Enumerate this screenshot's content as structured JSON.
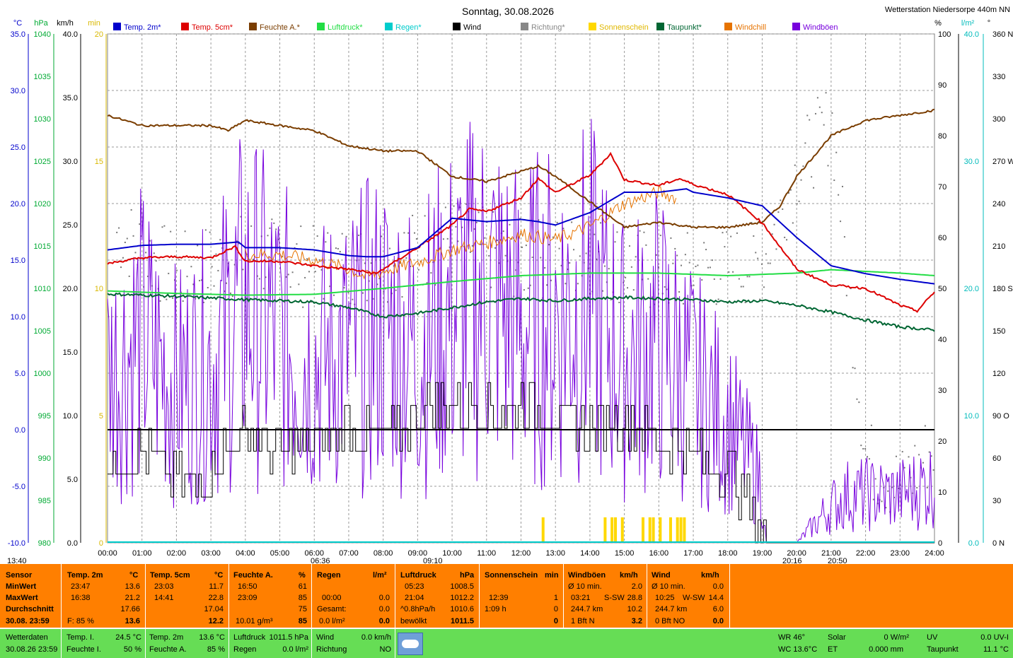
{
  "header": {
    "title": "Sonntag, 30.08.2026",
    "station": "Wetterstation Niedersorpe 440m NN"
  },
  "legend": [
    {
      "label": "Temp. 2m*",
      "color": "#0000cc"
    },
    {
      "label": "Temp. 5cm*",
      "color": "#dd0000"
    },
    {
      "label": "Feuchte A.*",
      "color": "#7a3d00"
    },
    {
      "label": "Luftdruck*",
      "color": "#22dd44"
    },
    {
      "label": "Regen*",
      "color": "#00cccc"
    },
    {
      "label": "Wind",
      "color": "#000000"
    },
    {
      "label": "Richtung*",
      "color": "#888888"
    },
    {
      "label": "Sonnenschein",
      "color": "#ffd800"
    },
    {
      "label": "Taupunkt*",
      "color": "#006633"
    },
    {
      "label": "Windchill",
      "color": "#e67300"
    },
    {
      "label": "Windböen",
      "color": "#7700dd"
    }
  ],
  "axes": {
    "left_units": [
      "°C",
      "hPa",
      "km/h",
      "min"
    ],
    "right_units": [
      "%",
      "l/m²",
      "°"
    ],
    "temp_ticks": [
      "35.0",
      "30.0",
      "25.0",
      "20.0",
      "15.0",
      "10.0",
      "5.0",
      "0.0",
      "-5.0",
      "-10.0"
    ],
    "hpa_ticks": [
      "1040",
      "1035",
      "1030",
      "1025",
      "1020",
      "1015",
      "1010",
      "1005",
      "1000",
      "995",
      "990",
      "985",
      "980"
    ],
    "kmh_ticks": [
      "40.0",
      "35.0",
      "30.0",
      "25.0",
      "20.0",
      "15.0",
      "10.0",
      "5.0",
      "0.0"
    ],
    "min_ticks": [
      "20",
      "15",
      "10",
      "5",
      "0"
    ],
    "pct_ticks": [
      "100",
      "90",
      "80",
      "70",
      "60",
      "50",
      "40",
      "30",
      "20",
      "10",
      "0"
    ],
    "rain_ticks": [
      "40.0",
      "30.0",
      "20.0",
      "10.0",
      "0.0"
    ],
    "dir_ticks": [
      "360 N",
      "330",
      "300",
      "270 W",
      "240",
      "210",
      "180 S",
      "150",
      "120",
      "90  O",
      "60",
      "30",
      "0  N"
    ],
    "x_ticks": [
      "00:00",
      "01:00",
      "02:00",
      "03:00",
      "04:00",
      "05:00",
      "06:00",
      "07:00",
      "08:00",
      "09:00",
      "10:00",
      "11:00",
      "12:00",
      "13:00",
      "14:00",
      "15:00",
      "16:00",
      "17:00",
      "18:00",
      "19:00",
      "20:00",
      "21:00",
      "22:00",
      "23:00",
      "24:00"
    ],
    "events": {
      "e1": "13:40",
      "e2": "06:36",
      "e3": "09:10",
      "e4": "20:16",
      "e5": "20:50"
    }
  },
  "chart_data": {
    "type": "line",
    "title": "Sonntag, 30.08.2026",
    "x_unit": "hour of day",
    "xlim": [
      0,
      24
    ],
    "ylim_temp_c": [
      -10,
      35
    ],
    "ylim_pressure_hpa": [
      980,
      1040
    ],
    "ylim_wind_kmh": [
      0,
      40
    ],
    "ylim_sun_min": [
      0,
      20
    ],
    "ylim_humidity_pct": [
      0,
      100
    ],
    "ylim_rain_lm2": [
      0,
      40
    ],
    "ylim_direction_deg": [
      0,
      360
    ],
    "grid": true,
    "legend": "top",
    "series": [
      {
        "name": "Temp. 2m*",
        "unit": "°C",
        "x": [
          0,
          1,
          2,
          3,
          3.8,
          4,
          5,
          6,
          7,
          7.5,
          8,
          9,
          10,
          11,
          12,
          12.5,
          13,
          14,
          15,
          16,
          16.8,
          17,
          18,
          19,
          20,
          21,
          22,
          23,
          24
        ],
        "values": [
          15.9,
          16.3,
          16.4,
          16.4,
          16.6,
          16.1,
          16.1,
          15.9,
          15.4,
          15.3,
          15.3,
          16.1,
          18.7,
          18.4,
          18.6,
          18.4,
          18.1,
          19.2,
          21.0,
          21.0,
          21.3,
          21.0,
          20.5,
          19.8,
          17.0,
          14.5,
          13.8,
          13.3,
          12.9
        ]
      },
      {
        "name": "Temp. 5cm*",
        "unit": "°C",
        "x": [
          0,
          1,
          2,
          3,
          3.7,
          4,
          5,
          6,
          7,
          7.8,
          8,
          9,
          10,
          10.5,
          11,
          12,
          12.5,
          13,
          14,
          14.6,
          15,
          16,
          16.6,
          17,
          18,
          19,
          20,
          21,
          22,
          23,
          23.5,
          24
        ],
        "values": [
          14.7,
          15.2,
          15.3,
          15.2,
          16.2,
          14.9,
          14.9,
          14.5,
          14.2,
          13.8,
          14.2,
          16.1,
          18.1,
          19.5,
          19.3,
          20.5,
          22.2,
          21.0,
          22.5,
          24.4,
          22.1,
          21.6,
          22.2,
          21.7,
          20.8,
          18.3,
          14.2,
          12.8,
          12.5,
          11.0,
          10.5,
          12.2
        ]
      },
      {
        "name": "Feuchte A.*",
        "unit": "%",
        "x": [
          0,
          0.5,
          1,
          2,
          3,
          3.5,
          4,
          5,
          6,
          7,
          8,
          9,
          10,
          11,
          12,
          12.5,
          13,
          14,
          15,
          16,
          17,
          18,
          19,
          19.5,
          20,
          21,
          22,
          23,
          24
        ],
        "values": [
          84,
          83,
          82,
          82,
          82,
          81,
          83,
          82,
          81,
          78,
          77,
          77,
          72,
          71,
          73,
          74,
          72,
          67,
          62,
          63,
          62,
          62,
          63,
          66,
          72,
          80,
          83,
          84,
          85
        ]
      },
      {
        "name": "Luftdruck*",
        "unit": "hPa",
        "x": [
          0,
          2,
          4,
          6,
          8,
          10,
          12,
          14,
          16,
          18,
          20,
          21,
          22,
          23,
          24
        ],
        "values": [
          1009.7,
          1009.4,
          1009.2,
          1009.3,
          1010.0,
          1010.8,
          1011.5,
          1011.8,
          1011.8,
          1011.5,
          1011.8,
          1012.2,
          1012.0,
          1011.8,
          1011.5
        ]
      },
      {
        "name": "Taupunkt*",
        "unit": "°C",
        "x": [
          0,
          2,
          4,
          6,
          7,
          8,
          9,
          10,
          11,
          12,
          13,
          14,
          15,
          16,
          17,
          18,
          19,
          20,
          21,
          22,
          23,
          24
        ],
        "values": [
          12.0,
          11.8,
          11.5,
          11.3,
          10.8,
          10.0,
          10.3,
          10.8,
          11.3,
          11.6,
          11.4,
          11.6,
          11.7,
          11.6,
          11.5,
          11.3,
          11.4,
          11.0,
          10.4,
          9.7,
          9.1,
          8.8
        ]
      },
      {
        "name": "Windchill",
        "unit": "°C",
        "x": [
          4,
          5,
          6,
          7,
          7.5,
          8,
          9,
          10,
          11,
          12,
          13,
          14,
          15,
          16,
          16.5
        ],
        "values": [
          15.5,
          15.5,
          15.0,
          14.2,
          13.5,
          14.0,
          14.8,
          15.9,
          16.5,
          17.3,
          16.8,
          18.0,
          20.0,
          21.0,
          20.5
        ]
      },
      {
        "name": "Wind",
        "unit": "km/h",
        "x": [
          0,
          1,
          2,
          2.5,
          3,
          4,
          5,
          6,
          7,
          8,
          9,
          10,
          11,
          12,
          13,
          14,
          15,
          16,
          17,
          18,
          19,
          19.2,
          20,
          21,
          22,
          23,
          24
        ],
        "values": [
          6,
          7,
          5,
          4,
          6,
          9,
          7,
          8,
          9,
          8,
          10,
          11,
          10,
          11,
          10,
          9,
          10,
          8,
          7,
          6,
          1,
          0,
          0,
          0,
          0,
          0,
          0
        ]
      },
      {
        "name": "Windböen",
        "unit": "km/h",
        "x": [
          0,
          1,
          2,
          3,
          4,
          5,
          6,
          7,
          8,
          9,
          10,
          11,
          12,
          13,
          14,
          15,
          16,
          17,
          18,
          19,
          19.1,
          20,
          21,
          21.5,
          22,
          23,
          24
        ],
        "values": [
          14,
          17,
          13,
          15,
          20,
          17,
          15,
          16,
          18,
          16,
          19,
          21,
          18,
          19,
          20,
          15,
          17,
          13,
          10,
          5,
          0,
          0,
          3,
          4,
          4,
          4,
          5
        ]
      },
      {
        "name": "Sonnenschein",
        "unit": "min",
        "x": [
          12.6,
          14.4,
          14.6,
          14.7,
          14.9,
          15.5,
          15.7,
          15.8,
          16.0,
          16.3,
          16.5,
          16.6,
          16.7
        ],
        "values": [
          1,
          1,
          1,
          1,
          1,
          1,
          1,
          1,
          1,
          1,
          1,
          1,
          1
        ]
      },
      {
        "name": "Richtung*",
        "unit": "°",
        "x": [
          0,
          2,
          4,
          6,
          8,
          10,
          12,
          14,
          16,
          18,
          19,
          20,
          21,
          22,
          23,
          24
        ],
        "values": [
          225,
          190,
          205,
          195,
          200,
          215,
          200,
          205,
          190,
          195,
          200,
          265,
          300,
          60,
          40,
          70
        ]
      }
    ]
  },
  "summary": {
    "headers": {
      "sensor": "Sensor",
      "t2": "Temp. 2m",
      "t2u": "°C",
      "t5": "Temp. 5cm",
      "t5u": "°C",
      "fa": "Feuchte A.",
      "fau": "%",
      "rg": "Regen",
      "rgu": "l/m²",
      "lp": "Luftdruck",
      "lpu": "hPa",
      "ss": "Sonnenschein",
      "ssu": "min",
      "wb": "Windböen",
      "wbu": "km/h",
      "wi": "Wind",
      "wiu": "km/h"
    },
    "rows": {
      "min": "MinWert",
      "max": "MaxWert",
      "avg": "Durchschnitt",
      "date": "30.08. 23:59"
    },
    "t2": {
      "min_time": "23:47",
      "min": "13.6",
      "max_time": "16:38",
      "max": "21.2",
      "avg": "17.66",
      "f": "F: 85 %",
      "cur": "13.6"
    },
    "t5": {
      "min_time": "23:03",
      "min": "11.7",
      "max_time": "14:41",
      "max": "22.8",
      "avg": "17.04",
      "cur": "12.2"
    },
    "fa": {
      "min_time": "16:50",
      "min": "61",
      "max_time": "23:09",
      "max": "85",
      "avg": "75",
      "abs": "10.01 g/m³",
      "cur": "85"
    },
    "rg": {
      "time": "00:00",
      "val": "0.0",
      "gesamt_label": "Gesamt:",
      "gesamt": "0.0",
      "cur_rate": "0.0 l/m²",
      "cur": "0.0"
    },
    "lp": {
      "min_time": "05:23",
      "min": "1008.5",
      "max_time": "21:04",
      "max": "1012.2",
      "trend": "^0.8hPa/h",
      "avg": "1010.6",
      "state": "bewölkt",
      "cur": "1011.5"
    },
    "ss": {
      "max_time": "12:39",
      "max": "1",
      "dur": "1:09 h",
      "dur_val": "0",
      "cur": "0"
    },
    "wb": {
      "avg_label": "Ø 10 min.",
      "avg": "2.0",
      "max_time": "03:21",
      "max_dir": "S-SW",
      "max": "28.8",
      "dist": "244.7 km",
      "dist_val": "10.2",
      "bft": "1 Bft N",
      "cur": "3.2"
    },
    "wi": {
      "avg_label": "Ø 10 min.",
      "avg": "0.0",
      "max_time": "10:25",
      "max_dir": "W-SW",
      "max": "14.4",
      "dist": "244.7 km",
      "dist_val": "6.0",
      "bft": "0 Bft NO",
      "cur": "0.0"
    }
  },
  "bottom": {
    "label": "Wetterdaten",
    "date": "30.08.26 23:59",
    "ti_label": "Temp. I.",
    "ti": "24.5 °C",
    "fi_label": "Feuchte I.",
    "fi": "50 %",
    "t2_label": "Temp. 2m",
    "t2": "13.6 °C",
    "fa_label": "Feuchte A.",
    "fa": "85 %",
    "lp_label": "Luftdruck",
    "lp": "1011.5 hPa",
    "rg_label": "Regen",
    "rg": "0.0 l/m²",
    "wind_label": "Wind",
    "wind": "0.0 km/h",
    "dir_label": "Richtung",
    "dir": "NO",
    "wr": "WR 46°",
    "wc": "WC 13.6°C",
    "solar_label": "Solar",
    "solar": "0 W/m²",
    "et_label": "ET",
    "et": "0.000 mm",
    "uv_label": "UV",
    "uv": "0.0 UV-I",
    "tp_label": "Taupunkt",
    "tp": "11.1 °C"
  }
}
